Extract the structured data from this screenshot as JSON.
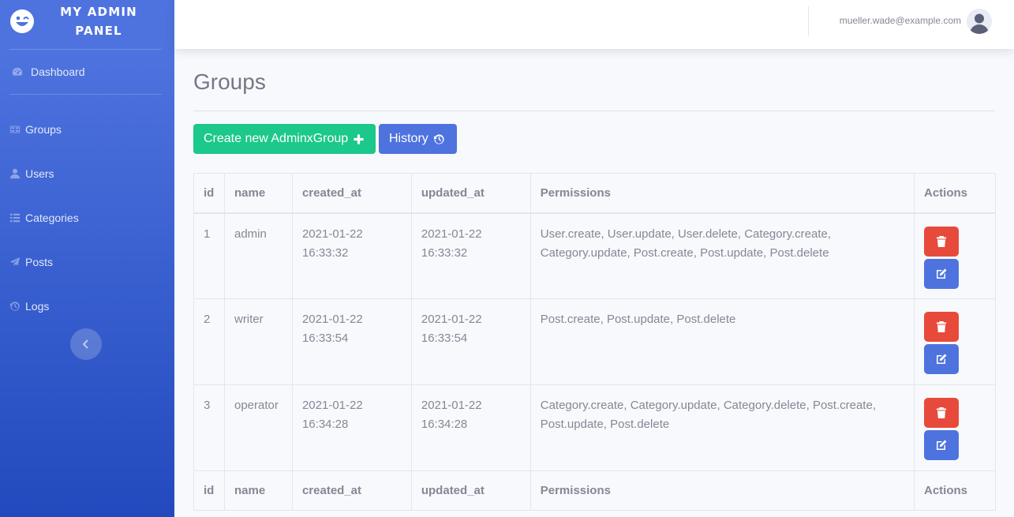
{
  "sidebar": {
    "brand": "MY ADMIN PANEL",
    "items": [
      {
        "label": "Dashboard",
        "icon": "tachometer-icon"
      },
      {
        "label": "Groups",
        "icon": "group-icon"
      },
      {
        "label": "Users",
        "icon": "user-icon"
      },
      {
        "label": "Categories",
        "icon": "list-icon"
      },
      {
        "label": "Posts",
        "icon": "paper-plane-icon"
      },
      {
        "label": "Logs",
        "icon": "history-icon"
      }
    ]
  },
  "topbar": {
    "user_email": "mueller.wade@example.com"
  },
  "page": {
    "title": "Groups",
    "create_button": "Create new AdminxGroup",
    "history_button": "History"
  },
  "table": {
    "columns": [
      "id",
      "name",
      "created_at",
      "updated_at",
      "Permissions",
      "Actions"
    ],
    "rows": [
      {
        "id": "1",
        "name": "admin",
        "created_date": "2021-01-22",
        "created_time": "16:33:32",
        "updated_date": "2021-01-22",
        "updated_time": "16:33:32",
        "permissions": "User.create, User.update, User.delete, Category.create, Category.update, Post.create, Post.update, Post.delete"
      },
      {
        "id": "2",
        "name": "writer",
        "created_date": "2021-01-22",
        "created_time": "16:33:54",
        "updated_date": "2021-01-22",
        "updated_time": "16:33:54",
        "permissions": "Post.create, Post.update, Post.delete"
      },
      {
        "id": "3",
        "name": "operator",
        "created_date": "2021-01-22",
        "created_time": "16:34:28",
        "updated_date": "2021-01-22",
        "updated_time": "16:34:28",
        "permissions": "Category.create, Category.update, Category.delete, Post.create, Post.update, Post.delete"
      }
    ]
  },
  "colors": {
    "primary": "#4e73df",
    "success": "#1cc88a",
    "danger": "#e74a3b"
  }
}
